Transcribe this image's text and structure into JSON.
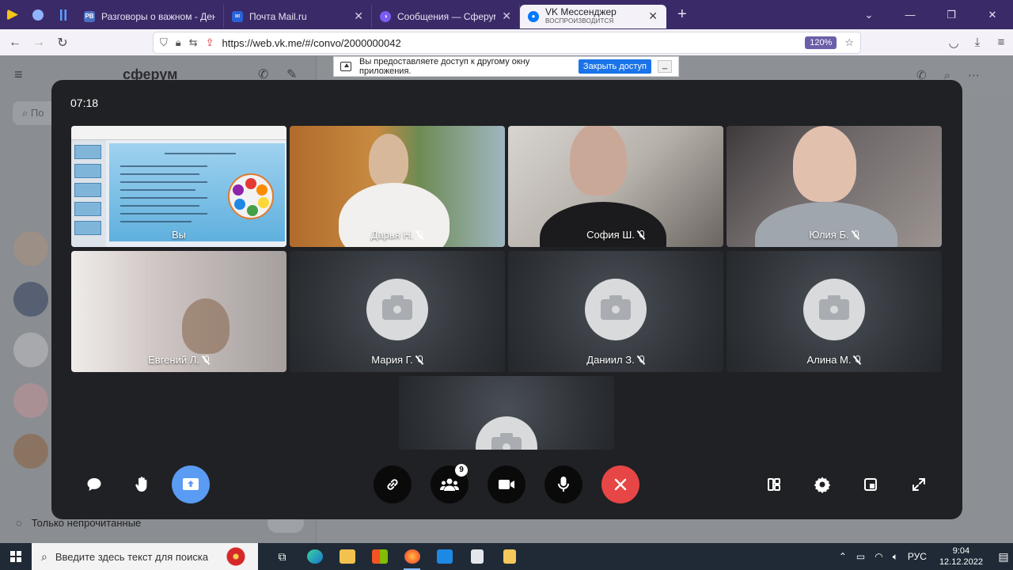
{
  "browser": {
    "tabs": [
      {
        "title": "Разговоры о важном - День К",
        "favicon": "РВ",
        "favicon_color": "#4c6fbf",
        "active": false
      },
      {
        "title": "Почта Mail.ru",
        "favicon": "✉",
        "favicon_color": "#2a62d8",
        "active": false
      },
      {
        "title": "Сообщения — Сферум",
        "favicon": "◑",
        "favicon_color": "#7a5cf0",
        "active": false
      },
      {
        "title": "VK Мессенджер",
        "subtitle": "ВОСПРОИЗВОДИТСЯ",
        "favicon": "●",
        "favicon_color": "#0077ff",
        "active": true
      }
    ],
    "new_tab": "+",
    "url": "https://web.vk.me/#/convo/2000000042",
    "zoom": "120%"
  },
  "background_app": {
    "logo": "сферум",
    "search_placeholder": "По",
    "unread_filter": "Только непрочитанные"
  },
  "share_notice": {
    "text": "Вы предоставляете доступ к другому окну приложения.",
    "stop_button": "Закрыть доступ"
  },
  "call": {
    "timer": "07:18",
    "participants": [
      {
        "name": "Вы",
        "muted": false,
        "video": "slides"
      },
      {
        "name": "Дарья Н.",
        "muted": true,
        "video": "room1"
      },
      {
        "name": "София Ш.",
        "muted": true,
        "video": "room2"
      },
      {
        "name": "Юлия Б.",
        "muted": true,
        "video": "room3"
      },
      {
        "name": "Евгений Л.",
        "muted": true,
        "video": "room4"
      },
      {
        "name": "Мария Г.",
        "muted": true,
        "video": "none"
      },
      {
        "name": "Даниил З.",
        "muted": true,
        "video": "none"
      },
      {
        "name": "Алина М.",
        "muted": true,
        "video": "none"
      },
      {
        "name": "",
        "muted": false,
        "video": "none"
      }
    ],
    "participants_count": "9",
    "colors": {
      "window": "#202124",
      "end_call": "#e64646",
      "screen_share": "#5a9bf3"
    }
  },
  "taskbar": {
    "search_placeholder": "Введите здесь текст для поиска",
    "lang": "РУС",
    "time": "9:04",
    "date": "12.12.2022"
  }
}
